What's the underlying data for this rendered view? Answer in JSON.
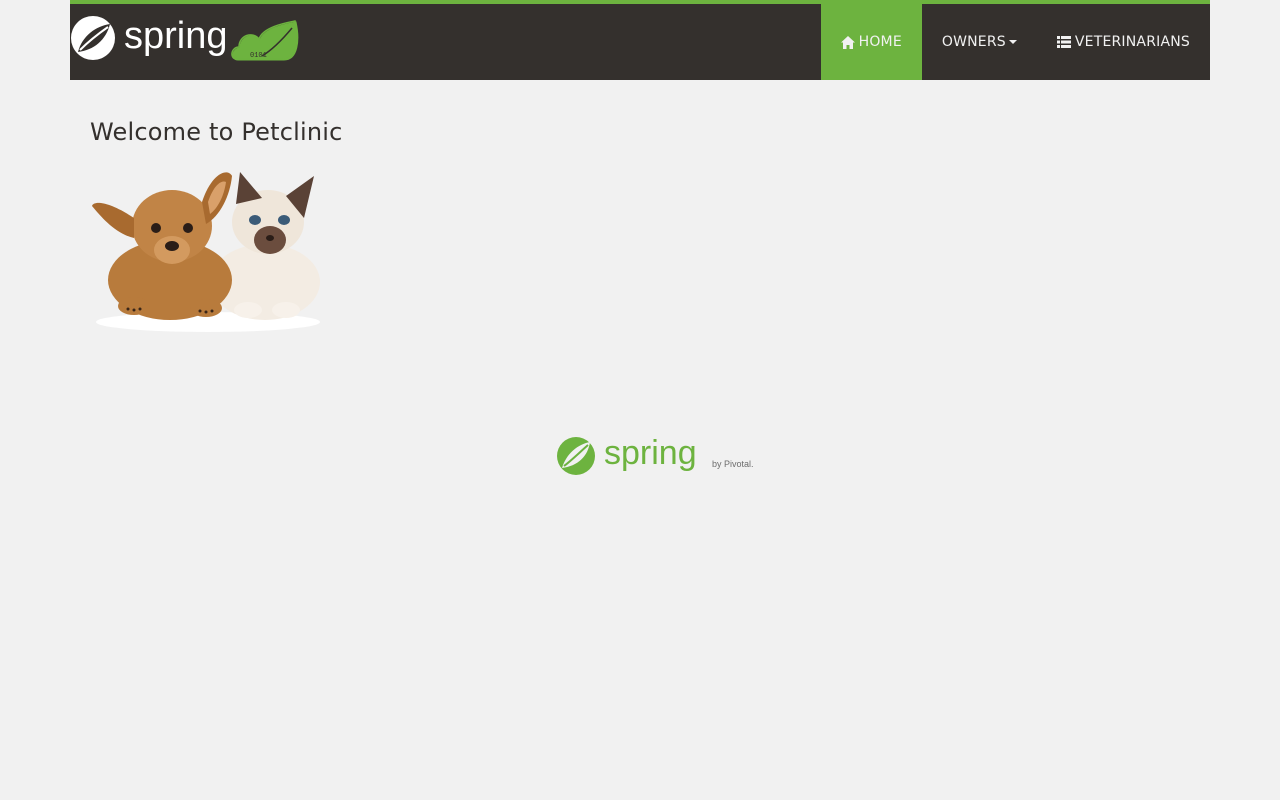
{
  "header": {
    "brand_logo": "spring-petclinic-logo",
    "accent_color": "#6db33f",
    "background_color": "#34302d",
    "nav": [
      {
        "label": "Home",
        "icon": "home-icon",
        "active": true
      },
      {
        "label": "Owners",
        "icon": "caret-down-icon",
        "active": false
      },
      {
        "label": "Veterinarians",
        "icon": "list-icon",
        "active": false
      }
    ]
  },
  "main": {
    "title": "Welcome to Petclinic",
    "image": "pets-image"
  },
  "footer": {
    "logo": "spring-by-pivotal-logo",
    "logo_text": "spring",
    "logo_subtext": "by Pivotal."
  }
}
